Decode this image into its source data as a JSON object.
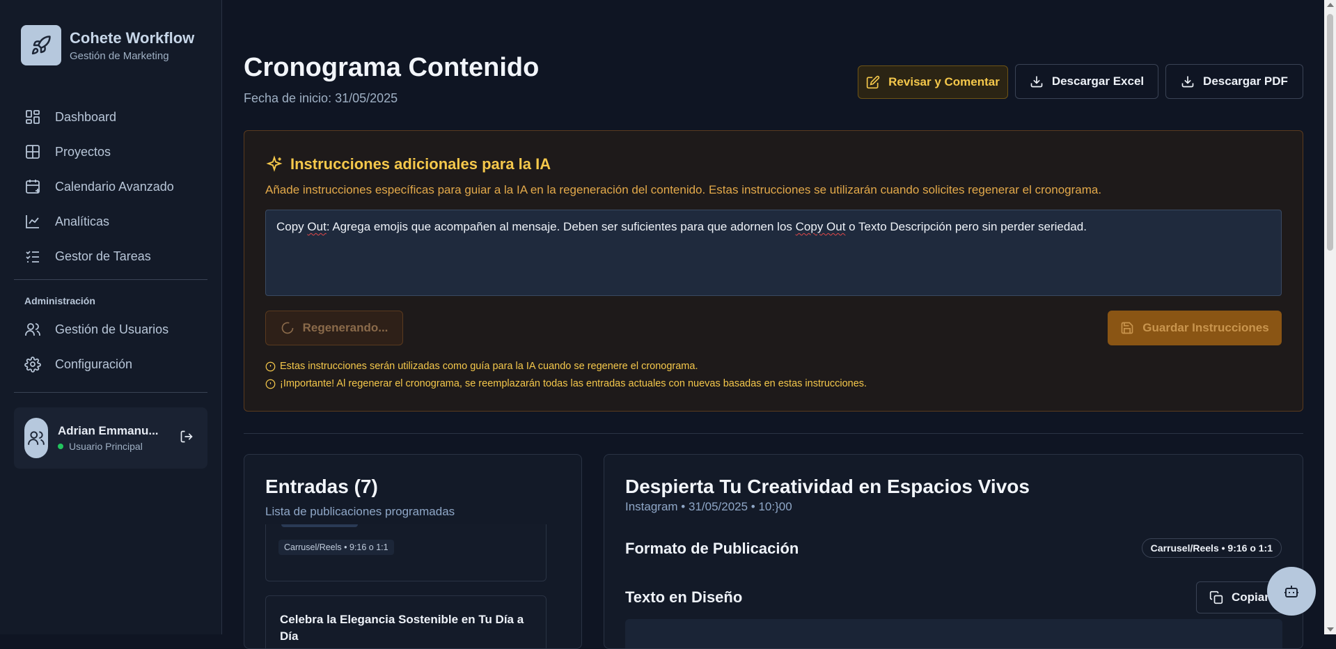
{
  "brand": {
    "title": "Cohete Workflow",
    "subtitle": "Gestión de Marketing"
  },
  "nav": {
    "items": [
      {
        "label": "Dashboard",
        "icon": "dashboard-icon"
      },
      {
        "label": "Proyectos",
        "icon": "grid-icon"
      },
      {
        "label": "Calendario Avanzado",
        "icon": "calendar-plus-icon"
      },
      {
        "label": "Analíticas",
        "icon": "line-chart-icon"
      },
      {
        "label": "Gestor de Tareas",
        "icon": "checklist-icon"
      }
    ],
    "admin_section": "Administración",
    "admin_items": [
      {
        "label": "Gestión de Usuarios",
        "icon": "users-icon"
      },
      {
        "label": "Configuración",
        "icon": "gear-icon"
      }
    ]
  },
  "user": {
    "name": "Adrian Emmanu...",
    "status": "Usuario Principal",
    "status_color": "#22c55e"
  },
  "header": {
    "title": "Cronograma Contenido",
    "subtitle": "Fecha de inicio: 31/05/2025",
    "review_label": "Revisar y Comentar",
    "excel_label": "Descargar Excel",
    "pdf_label": "Descargar PDF"
  },
  "ai_panel": {
    "title": "Instrucciones adicionales para la IA",
    "description": "Añade instrucciones específicas para guiar a la IA en la regeneración del contenido. Estas instrucciones se utilizarán cuando solicites regenerar el cronograma.",
    "textarea": {
      "t1": "Copy ",
      "t2": "Out",
      "t3": ": Agrega emojis que acompañen al mensaje. Deben ser suficientes para que adornen los ",
      "t4": "Copy Out",
      "t5": " o Texto Descripción pero sin perder seriedad."
    },
    "regen_label": "Regenerando...",
    "save_label": "Guardar Instrucciones",
    "note1": "Estas instrucciones serán utilizadas como guía para la IA cuando se regenere el cronograma.",
    "note2": "¡Importante! Al regenerar el cronograma, se reemplazarán todas las entradas actuales con nuevas basadas en estas instrucciones.",
    "accent": "#f5c84b"
  },
  "entries": {
    "title": "Entradas (7)",
    "subtitle": "Lista de publicaciones programadas",
    "items": [
      {
        "tag": "Carrusel/Reels • 9:16 o 1:1"
      },
      {
        "title": "Celebra la Elegancia Sostenible en Tu Día a Día"
      }
    ]
  },
  "detail": {
    "title": "Despierta Tu Creatividad en Espacios Vivos",
    "meta": "Instagram • 31/05/2025 • 10:}00",
    "format_heading": "Formato de Publicación",
    "format_value": "Carrusel/Reels • 9:16 o 1:1",
    "text_heading": "Texto en Diseño",
    "copy_label": "Copiar"
  }
}
